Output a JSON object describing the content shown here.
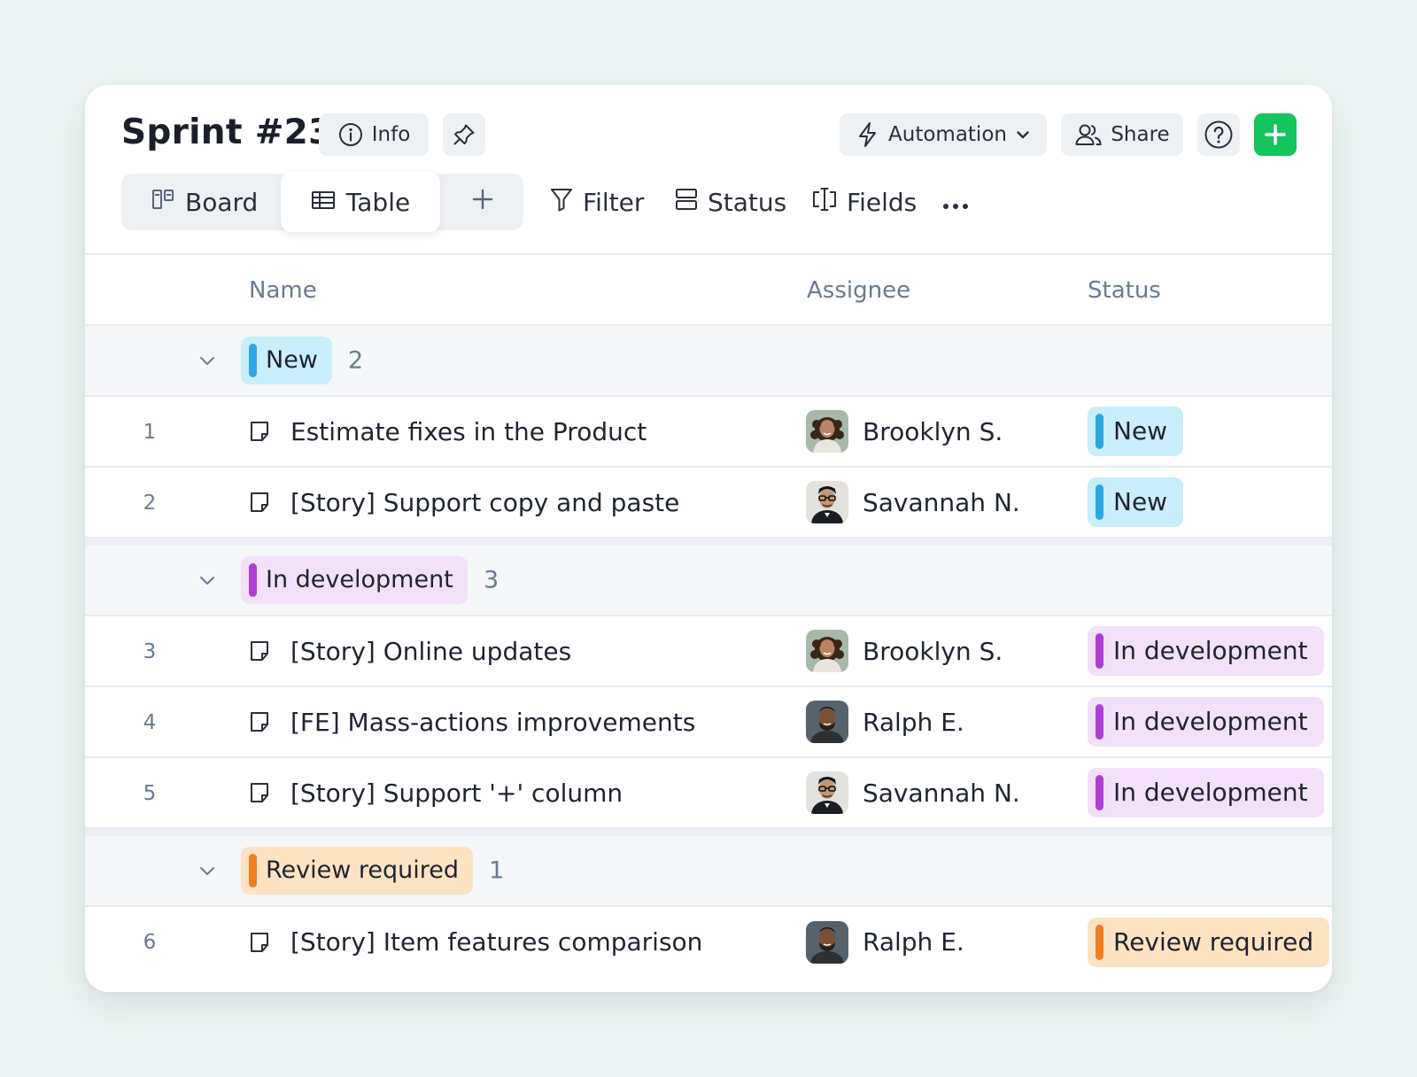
{
  "header": {
    "title": "Sprint #23",
    "info_label": "Info",
    "automation_label": "Automation",
    "share_label": "Share",
    "accent_color": "#14c45c"
  },
  "views": {
    "board_label": "Board",
    "table_label": "Table",
    "active": "Table"
  },
  "toolbar": {
    "filter_label": "Filter",
    "status_label": "Status",
    "fields_label": "Fields"
  },
  "table": {
    "columns": {
      "name": "Name",
      "assignee": "Assignee",
      "status": "Status"
    }
  },
  "groups": [
    {
      "label": "New",
      "count": "2",
      "color": "#2ea7e6",
      "bg": "#c9eefc",
      "rows": [
        {
          "num": "1",
          "name": "Estimate fixes in the Product",
          "assignee": "Brooklyn S.",
          "avatar": "woman-curly",
          "status": "New"
        },
        {
          "num": "2",
          "name": "[Story] Support copy and paste",
          "assignee": "Savannah N.",
          "avatar": "man-glasses",
          "status": "New"
        }
      ]
    },
    {
      "label": "In development",
      "count": "3",
      "color": "#b03ed6",
      "bg": "#f3e0f9",
      "rows": [
        {
          "num": "3",
          "name": "[Story] Online updates",
          "assignee": "Brooklyn S.",
          "avatar": "woman-curly",
          "status": "In development"
        },
        {
          "num": "4",
          "name": "[FE] Mass-actions improvements",
          "assignee": "Ralph E.",
          "avatar": "man-beard",
          "status": "In development"
        },
        {
          "num": "5",
          "name": "[Story] Support '+' column",
          "assignee": "Savannah N.",
          "avatar": "man-glasses",
          "status": "In development"
        }
      ]
    },
    {
      "label": "Review required",
      "count": "1",
      "color": "#ef7f1e",
      "bg": "#fde3c2",
      "rows": [
        {
          "num": "6",
          "name": "[Story] Item features comparison",
          "assignee": "Ralph E.",
          "avatar": "man-beard",
          "status": "Review required"
        }
      ]
    }
  ]
}
